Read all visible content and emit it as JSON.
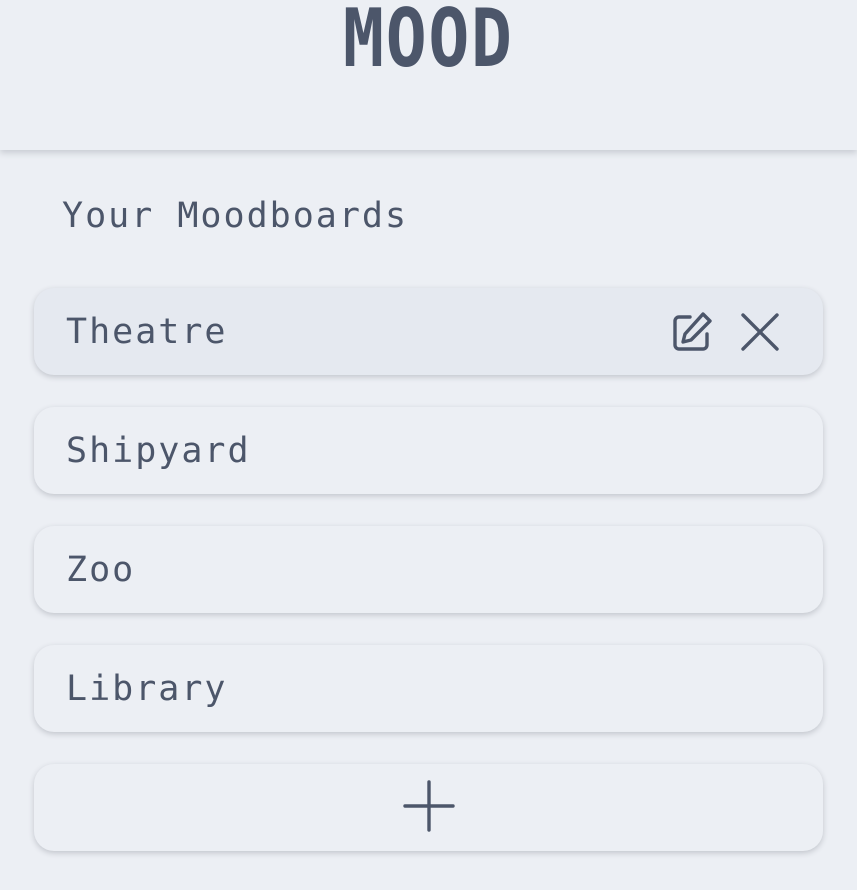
{
  "app": {
    "title": "MOOD"
  },
  "section": {
    "title": "Your Moodboards"
  },
  "boards": [
    {
      "name": "Theatre",
      "active": true
    },
    {
      "name": "Shipyard",
      "active": false
    },
    {
      "name": "Zoo",
      "active": false
    },
    {
      "name": "Library",
      "active": false
    }
  ],
  "icons": {
    "edit": "edit-icon",
    "delete": "close-icon",
    "add": "plus-icon"
  },
  "colors": {
    "background": "#eceff4",
    "active_card": "#e5e9f0",
    "text": "#4c566a"
  }
}
